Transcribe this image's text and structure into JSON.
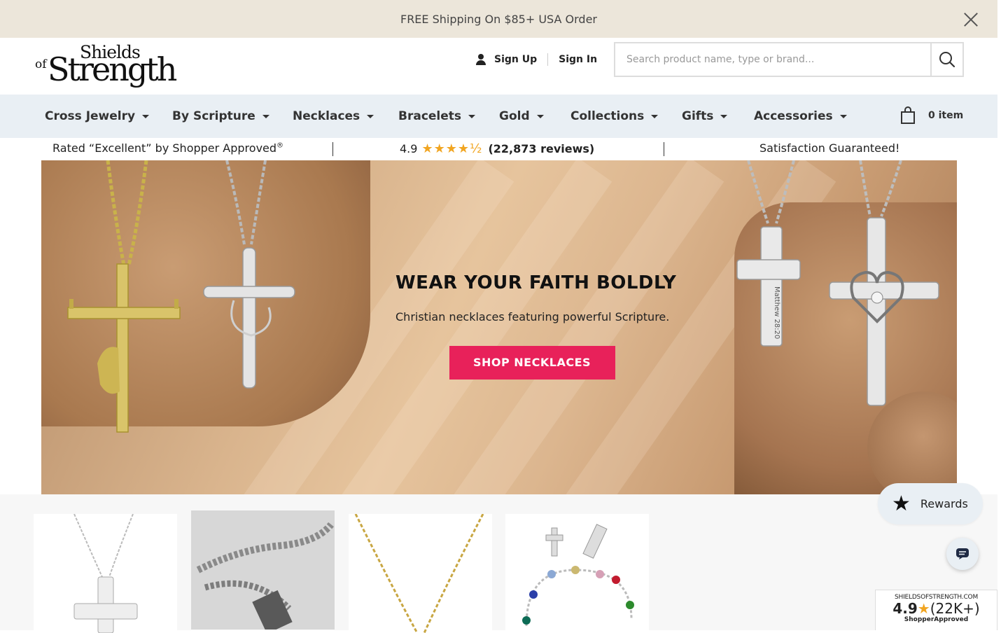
{
  "announcement": {
    "text": "FREE Shipping On $85+ USA Order"
  },
  "logo": {
    "of": "of",
    "shields": "Shields",
    "strength": "Strength"
  },
  "account": {
    "sign_up": "Sign Up",
    "sign_in": "Sign In"
  },
  "search": {
    "placeholder": "Search product name, type or brand..."
  },
  "nav": {
    "items": [
      {
        "label": "Cross Jewelry"
      },
      {
        "label": "By Scripture"
      },
      {
        "label": "Necklaces"
      },
      {
        "label": "Bracelets"
      },
      {
        "label": "Gold"
      },
      {
        "label": "Collections"
      },
      {
        "label": "Gifts"
      },
      {
        "label": "Accessories"
      }
    ],
    "cart_label": "0 item"
  },
  "ratings": {
    "rated_text": "Rated “Excellent” by Shopper Approved",
    "rated_mark": "®",
    "score": "4.9",
    "stars": "★★★★½",
    "reviews": "(22,873 reviews)",
    "guarantee": "Satisfaction Guaranteed!"
  },
  "hero": {
    "title": "WEAR YOUR FAITH BOLDLY",
    "subtitle": "Christian necklaces featuring powerful Scripture.",
    "cta": "SHOP NECKLACES",
    "engraving": "Matthew 28:20"
  },
  "widgets": {
    "rewards_label": "Rewards",
    "badge_site": "SHIELDSOFSTRENGTH.COM",
    "badge_score": "4.9",
    "badge_count": "(22K+)",
    "badge_brand": "ShopperApproved"
  },
  "colors": {
    "announce_bg": "#ece6da",
    "nav_bg": "#e9eff4",
    "cta": "#e8215a",
    "stars": "#f1a521"
  }
}
